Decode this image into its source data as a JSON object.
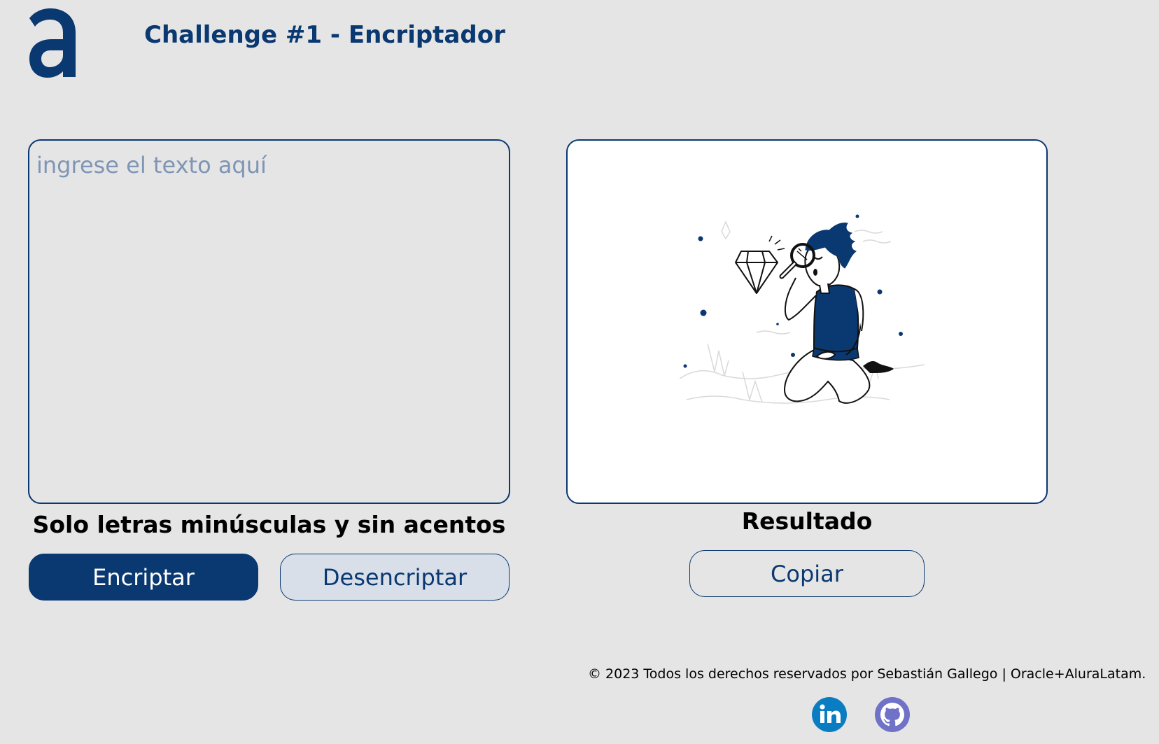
{
  "header": {
    "title": "Challenge #1 - Encriptador",
    "logo_icon": "alura-logo-icon"
  },
  "input": {
    "placeholder": "ingrese el texto aquí",
    "value": ""
  },
  "hint": "Solo letras minúsculas y sin acentos",
  "buttons": {
    "encrypt": "Encriptar",
    "decrypt": "Desencriptar",
    "copy": "Copiar"
  },
  "output": {
    "label": "Resultado",
    "illustration_icon": "person-with-magnifier-diamond-icon"
  },
  "footer": {
    "text": "© 2023 Todos los derechos reservados por Sebastián Gallego | Oracle+AluraLatam."
  },
  "social": {
    "linkedin_icon": "linkedin-icon",
    "github_icon": "github-icon"
  },
  "colors": {
    "primary": "#0a3871",
    "background": "#e5e5e5",
    "linkedin": "#0a7dc2",
    "github": "#6f72c7"
  }
}
